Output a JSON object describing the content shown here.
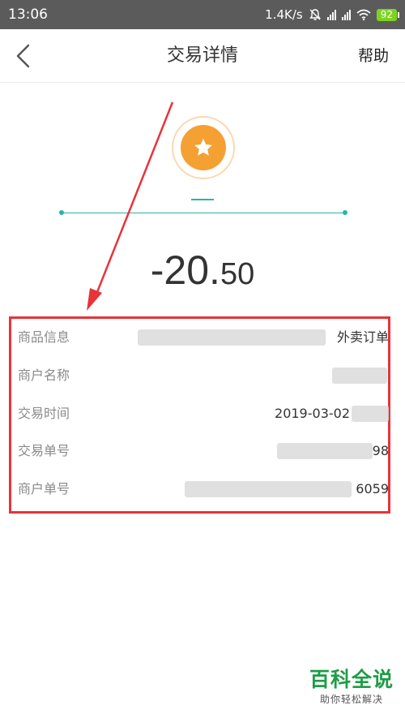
{
  "status_bar": {
    "time": "13:06",
    "network_speed": "1.4K/s",
    "battery": "92",
    "icons": [
      "mute-bell-icon",
      "signal-icon",
      "signal-icon",
      "wifi-icon",
      "battery-icon"
    ]
  },
  "nav": {
    "back_icon": "chevron-left-icon",
    "title": "交易详情",
    "help_label": "帮助"
  },
  "merchant": {
    "logo_icon": "star-icon",
    "logo_color": "#f5a033",
    "accent_color": "#27b6a5"
  },
  "amount": {
    "integer_part": "-20.",
    "decimal_part": "50"
  },
  "details": [
    {
      "label": "商品信息",
      "value": "外卖订单"
    },
    {
      "label": "商户名称",
      "value": ""
    },
    {
      "label": "交易时间",
      "value": "2019-03-02"
    },
    {
      "label": "交易单号",
      "value": "98"
    },
    {
      "label": "商户单号",
      "value": "6059"
    }
  ],
  "annotation": {
    "highlight_color": "#e83339",
    "arrow_icon": "red-arrow-icon"
  },
  "watermark": {
    "title": "百科全说",
    "subtitle": "助你轻松解决"
  }
}
